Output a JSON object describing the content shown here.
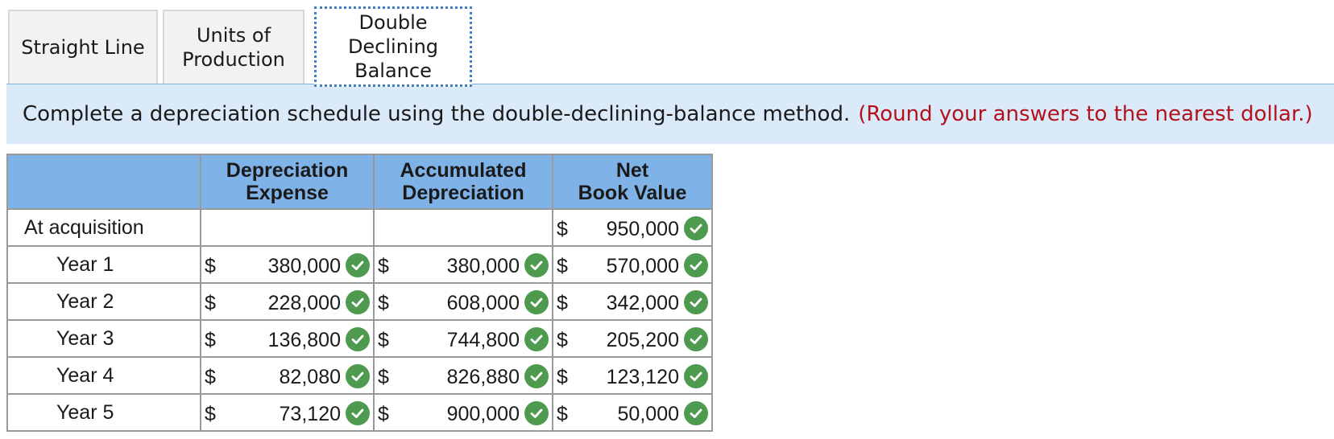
{
  "tabs": [
    {
      "label": "Straight Line"
    },
    {
      "label": "Units of\nProduction"
    },
    {
      "label": "Double\nDeclining\nBalance"
    }
  ],
  "instruction": {
    "text": "Complete a depreciation schedule using the double-declining-balance method.",
    "hint": "(Round your answers to the nearest dollar.)"
  },
  "table": {
    "headers": [
      "",
      "Depreciation\nExpense",
      "Accumulated\nDepreciation",
      "Net\nBook Value"
    ],
    "currency": "$",
    "rows": [
      {
        "label": "At acquisition",
        "dep": "",
        "acc": "",
        "nbv": "950,000"
      },
      {
        "label": "Year 1",
        "dep": "380,000",
        "acc": "380,000",
        "nbv": "570,000"
      },
      {
        "label": "Year 2",
        "dep": "228,000",
        "acc": "608,000",
        "nbv": "342,000"
      },
      {
        "label": "Year 3",
        "dep": "136,800",
        "acc": "744,800",
        "nbv": "205,200"
      },
      {
        "label": "Year 4",
        "dep": "82,080",
        "acc": "826,880",
        "nbv": "123,120"
      },
      {
        "label": "Year 5",
        "dep": "73,120",
        "acc": "900,000",
        "nbv": "50,000"
      }
    ]
  },
  "colors": {
    "header_bg": "#7fb2e6",
    "instruction_bg": "#dbeaf8",
    "hint_text": "#b3121d",
    "check_green": "#4e9a4f",
    "active_tab_border": "#3e7fc1"
  },
  "icons": {
    "correct": "check-circle-icon"
  }
}
